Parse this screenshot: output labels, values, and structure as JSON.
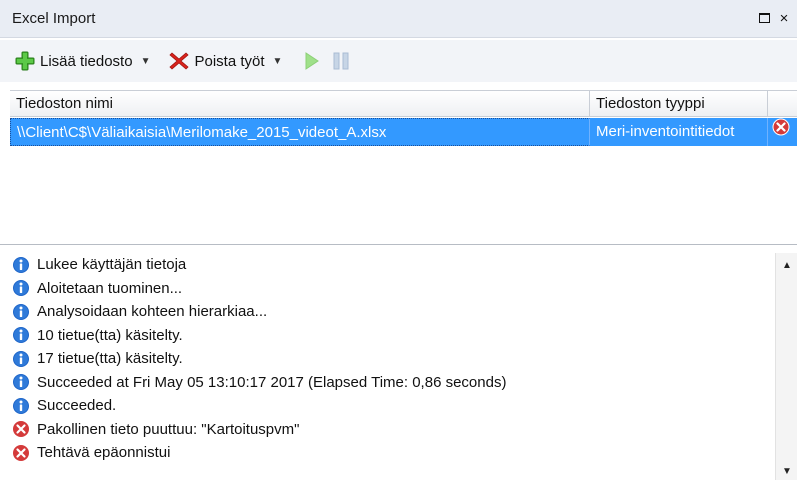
{
  "window": {
    "title": "Excel Import",
    "maximize_icon": "maximize-icon",
    "close_label": "×"
  },
  "toolbar": {
    "add_file_label": "Lisää tiedosto",
    "remove_jobs_label": "Poista työt",
    "dropdown_glyph": "▼",
    "icons": [
      "add-icon",
      "delete-x-icon",
      "play-icon",
      "pause-icon"
    ]
  },
  "grid": {
    "columns": [
      "Tiedoston nimi",
      "Tiedoston tyyppi",
      ""
    ],
    "rows": [
      {
        "filename": "\\\\Client\\C$\\Väliaikaisia\\Merilomake_2015_videot_A.xlsx",
        "type": "Meri-inventointitiedot",
        "status_icon": "error-icon"
      }
    ]
  },
  "log": {
    "entries": [
      {
        "icon": "info-icon",
        "text": "Lukee käyttäjän tietoja"
      },
      {
        "icon": "info-icon",
        "text": "Aloitetaan tuominen..."
      },
      {
        "icon": "info-icon",
        "text": "Analysoidaan kohteen hierarkiaa..."
      },
      {
        "icon": "info-icon",
        "text": "10 tietue(tta) käsitelty."
      },
      {
        "icon": "info-icon",
        "text": "17 tietue(tta) käsitelty."
      },
      {
        "icon": "info-icon",
        "text": "Succeeded at Fri May 05 13:10:17 2017 (Elapsed Time: 0,86 seconds)"
      },
      {
        "icon": "info-icon",
        "text": "Succeeded."
      },
      {
        "icon": "error-icon",
        "text": "Pakollinen tieto puuttuu: \"Kartoituspvm\""
      },
      {
        "icon": "error-icon",
        "text": "Tehtävä epäonnistui"
      }
    ]
  },
  "colors": {
    "selection": "#3399ff",
    "info": "#1f66c9",
    "error": "#d43a3a",
    "add_green": "#3fae2a",
    "delete_red": "#d9221c"
  }
}
